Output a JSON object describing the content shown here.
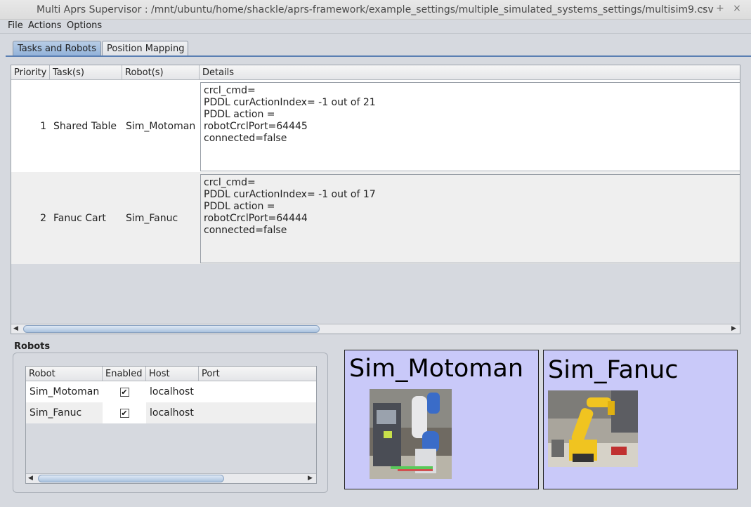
{
  "window": {
    "title": "Multi Aprs Supervisor : /mnt/ubuntu/home/shackle/aprs-framework/example_settings/multiple_simulated_systems_settings/multisim9.csv",
    "buttons": [
      "minimize",
      "maximize",
      "close"
    ]
  },
  "menu": [
    "File",
    "Actions",
    "Options"
  ],
  "tabs": [
    {
      "label": "Tasks and Robots",
      "active": true
    },
    {
      "label": "Position Mapping",
      "active": false
    }
  ],
  "task_table": {
    "columns": [
      "Priority",
      "Task(s)",
      "Robot(s)",
      "Details"
    ],
    "rows": [
      {
        "priority": "1",
        "task": "Shared Table",
        "robot": "Sim_Motoman",
        "details": [
          "crcl_cmd=",
          "PDDL curActionIndex= -1 out of 21",
          "PDDL action =",
          "robotCrclPort=64445",
          "connected=false"
        ]
      },
      {
        "priority": "2",
        "task": "Fanuc Cart",
        "robot": "Sim_Fanuc",
        "details": [
          "crcl_cmd=",
          "PDDL curActionIndex= -1 out of 17",
          "PDDL action =",
          "robotCrclPort=64444",
          "connected=false"
        ]
      }
    ]
  },
  "robots_section": {
    "label": "Robots",
    "columns": [
      "Robot",
      "Enabled",
      "Host",
      "Port"
    ],
    "rows": [
      {
        "robot": "Sim_Motoman",
        "enabled": true,
        "host": "localhost",
        "port": ""
      },
      {
        "robot": "Sim_Fanuc",
        "enabled": true,
        "host": "localhost",
        "port": ""
      }
    ]
  },
  "robot_cards": [
    {
      "name": "Sim_Motoman"
    },
    {
      "name": "Sim_Fanuc"
    }
  ],
  "colors": {
    "window_bg": "#d6d9df",
    "card_bg": "#c9c9f9",
    "tab_active": "#a9c2de",
    "tab_underline": "#5a7fb3"
  }
}
